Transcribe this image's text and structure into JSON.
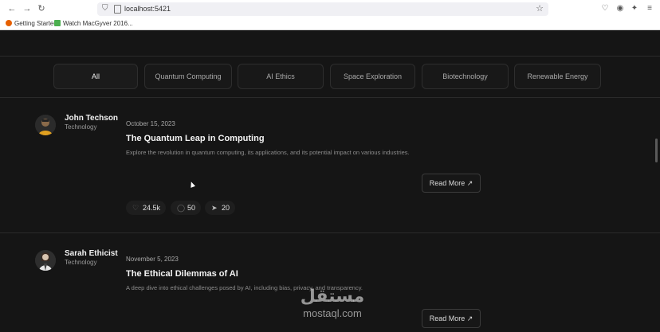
{
  "browser": {
    "url": "localhost:5421",
    "bookmarks": [
      {
        "label": "Getting Started",
        "icon": "firefox-icon",
        "color": "#e66000"
      },
      {
        "label": "Watch MacGyver 2016...",
        "icon": "bookmark-site-icon",
        "color": "#4caf50"
      }
    ]
  },
  "filters": [
    {
      "label": "All",
      "active": true
    },
    {
      "label": "Quantum Computing",
      "active": false
    },
    {
      "label": "AI Ethics",
      "active": false
    },
    {
      "label": "Space Exploration",
      "active": false
    },
    {
      "label": "Biotechnology",
      "active": false
    },
    {
      "label": "Renewable Energy",
      "active": false
    }
  ],
  "posts": [
    {
      "author": "John Techson",
      "category": "Technology",
      "date": "October 15, 2023",
      "title": "The Quantum Leap in Computing",
      "excerpt": "Explore the revolution in quantum computing, its applications, and its potential impact on various industries.",
      "read_more": "Read More ↗",
      "stats": {
        "likes": "24.5k",
        "comments": "50",
        "shares": "20"
      }
    },
    {
      "author": "Sarah Ethicist",
      "category": "Technology",
      "date": "November 5, 2023",
      "title": "The Ethical Dilemmas of AI",
      "excerpt": "A deep dive into ethical challenges posed by AI, including bias, privacy, and transparency.",
      "read_more": "Read More ↗"
    }
  ],
  "watermark": {
    "arabic": "مستقل",
    "latin": "mostaql.com"
  }
}
